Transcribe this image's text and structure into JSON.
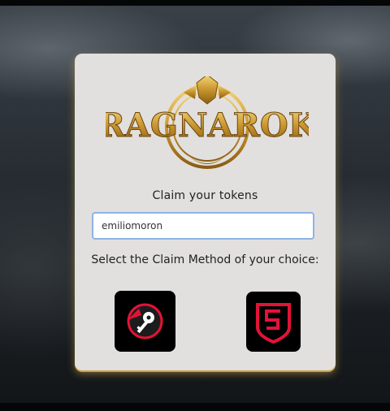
{
  "brand": {
    "logo_text": "RAGNAROK"
  },
  "claim": {
    "title": "Claim your tokens",
    "username_value": "emiliomoron",
    "method_prompt": "Select the Claim Method of your choice:"
  },
  "methods": [
    {
      "name": "keychain",
      "icon": "key-icon",
      "accent": "#e31337"
    },
    {
      "name": "hivesigner",
      "icon": "shield-icon",
      "accent": "#e31337"
    }
  ],
  "colors": {
    "card": "#e2e0de",
    "input_border": "#8fb3e6",
    "gold": "#c9a24a"
  }
}
